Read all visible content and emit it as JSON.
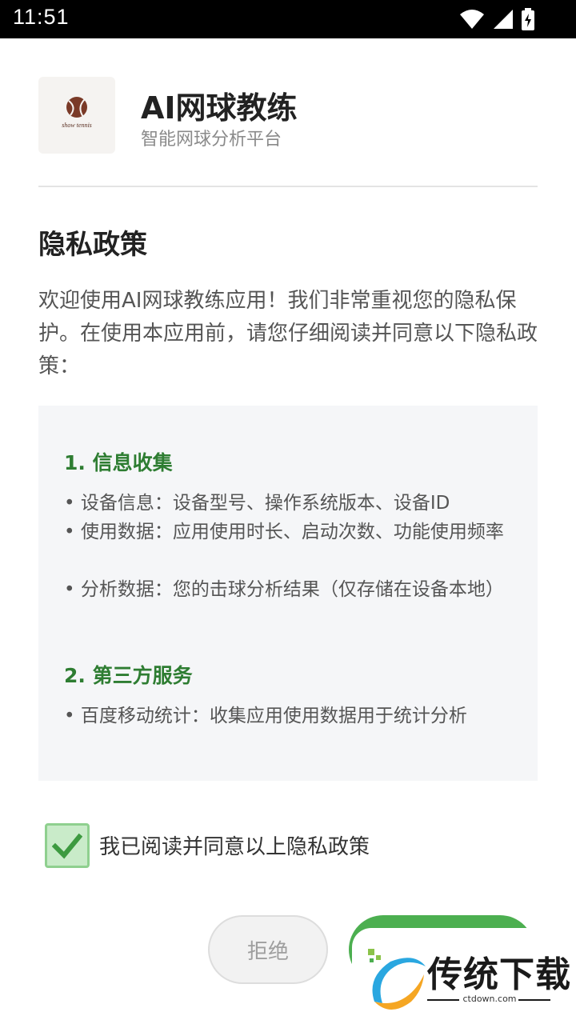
{
  "status_bar": {
    "time": "11:51",
    "icons": [
      "wifi-icon",
      "signal-icon",
      "battery-charging-icon"
    ]
  },
  "app": {
    "logo_text": "show tennis",
    "title": "AI网球教练",
    "subtitle": "智能网球分析平台"
  },
  "policy": {
    "title": "隐私政策",
    "intro": "欢迎使用AI网球教练应用！我们非常重视您的隐私保护。在使用本应用前，请您仔细阅读并同意以下隐私政策：",
    "sections": [
      {
        "heading": "1. 信息收集",
        "bullets": [
          "• 设备信息：设备型号、操作系统版本、设备ID",
          "• 使用数据：应用使用时长、启动次数、功能使用频率",
          "• 分析数据：您的击球分析结果（仅存储在设备本地）"
        ]
      },
      {
        "heading": "2. 第三方服务",
        "bullets": [
          "• 百度移动统计：收集应用使用数据用于统计分析"
        ]
      }
    ]
  },
  "consent": {
    "checked": true,
    "label": "我已阅读并同意以上隐私政策"
  },
  "buttons": {
    "reject": "拒绝",
    "agree": ""
  },
  "watermark": {
    "text": "传统下载",
    "url": "ctdown.com"
  },
  "colors": {
    "accent": "#4caf50",
    "heading_green": "#2e7d32",
    "box_bg": "#f5f6f8"
  }
}
